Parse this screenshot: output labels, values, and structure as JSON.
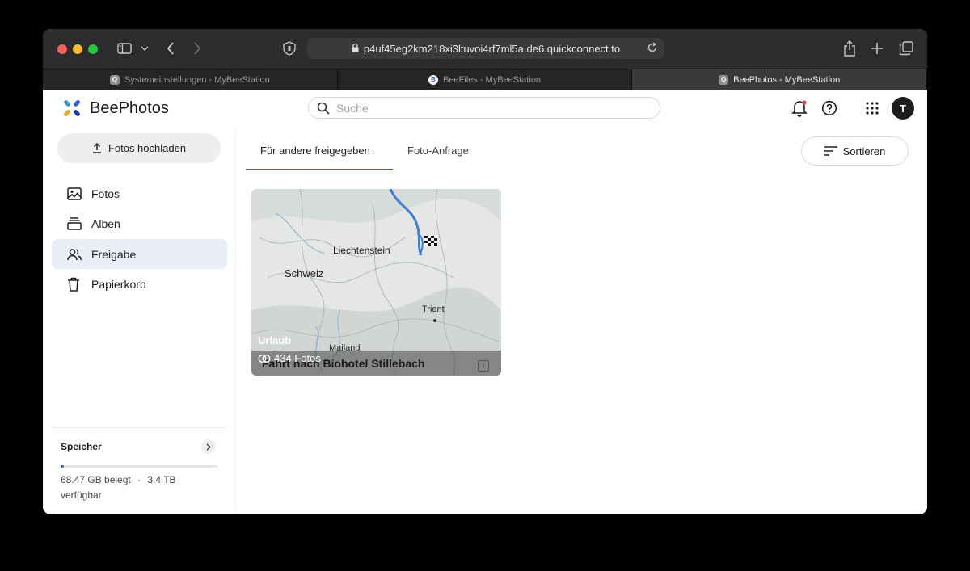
{
  "browser": {
    "url": "p4uf45eg2km218xi3ltuvoi4rf7ml5a.de6.quickconnect.to",
    "tabs": [
      {
        "label": "Systemeinstellungen - MyBeeStation",
        "favicon": "q-icon"
      },
      {
        "label": "BeeFiles - MyBeeStation",
        "favicon": "beefiles-icon"
      },
      {
        "label": "BeePhotos - MyBeeStation",
        "favicon": "q-icon"
      }
    ]
  },
  "app": {
    "name": "BeePhotos",
    "search_placeholder": "Suche",
    "avatar_initial": "T",
    "accent": "#2d5fd6"
  },
  "sidebar": {
    "upload_label": "Fotos hochladen",
    "items": [
      {
        "label": "Fotos",
        "icon": "image-icon"
      },
      {
        "label": "Alben",
        "icon": "album-icon"
      },
      {
        "label": "Freigabe",
        "icon": "people-icon"
      },
      {
        "label": "Papierkorb",
        "icon": "trash-icon"
      }
    ],
    "storage": {
      "title": "Speicher",
      "used": "68.47 GB belegt",
      "separator": "·",
      "available": "3.4 TB verfügbar",
      "fill_fraction": 0.02
    }
  },
  "main": {
    "tabs": [
      "Für andere freigegeben",
      "Foto-Anfrage"
    ],
    "sort_label": "Sortieren",
    "album": {
      "title": "Urlaub",
      "count": "434 Fotos",
      "map_title": "Fahrt nach Biohotel Stillebach",
      "map_labels": [
        "Liechtenstein",
        "Schweiz",
        "Trient",
        "Mailand"
      ]
    }
  }
}
